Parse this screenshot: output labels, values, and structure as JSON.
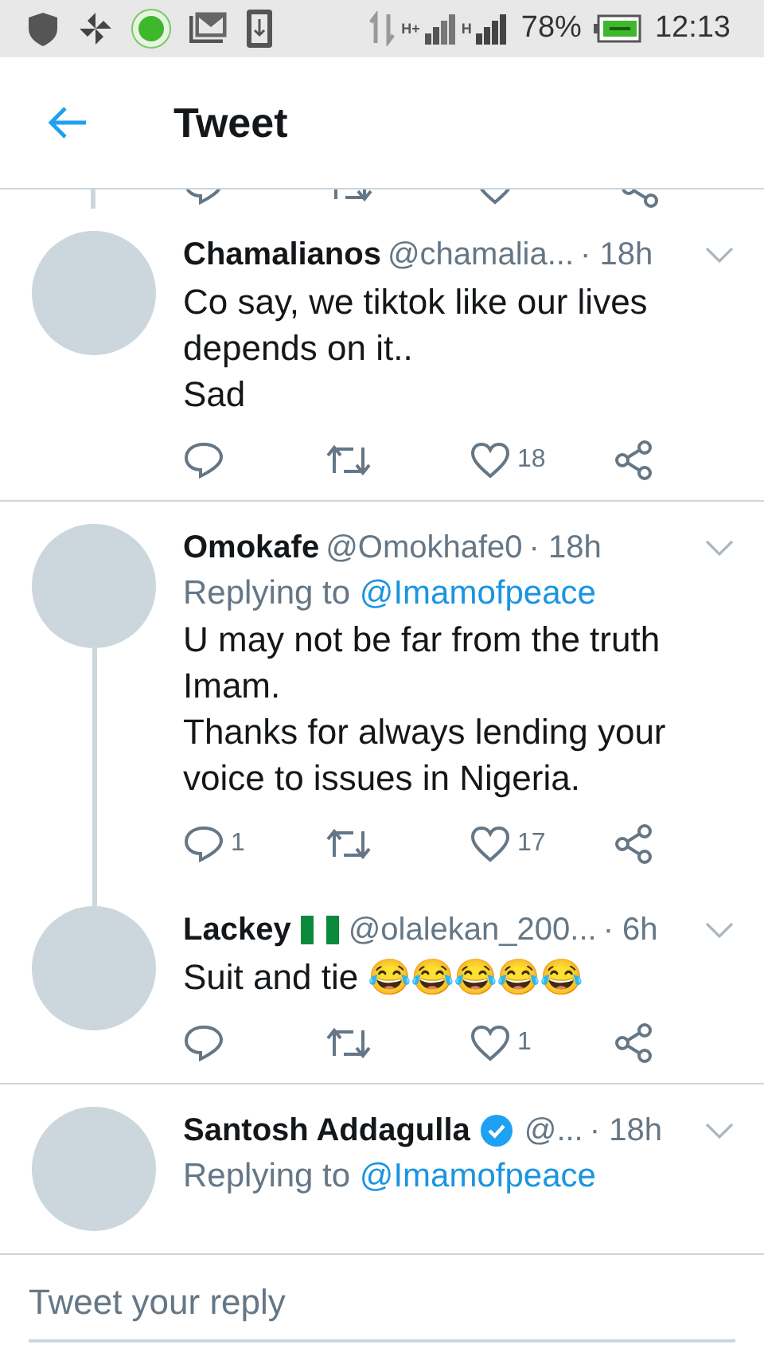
{
  "status_bar": {
    "network_labels": [
      "H+",
      "H"
    ],
    "battery": "78%",
    "time": "12:13"
  },
  "header": {
    "title": "Tweet"
  },
  "tweets": [
    {
      "name": "Chamalianos",
      "handle": "@chamalia...",
      "time": "· 18h",
      "lines": [
        "Co say, we tiktok like our lives",
        "depends on it..",
        "Sad"
      ],
      "likes": "18",
      "thread_above": false,
      "thread_below": false,
      "divider": true
    },
    {
      "name": "Omokafe",
      "handle": "@Omokhafe0",
      "time": "· 18h",
      "replying_to": {
        "label": "Replying to",
        "mention": "@Imamofpeace"
      },
      "lines": [
        "U may not be far from the truth",
        "Imam.",
        "Thanks for always lending your",
        "voice to issues in Nigeria."
      ],
      "replies": "1",
      "likes": "17",
      "thread_above": false,
      "thread_below": true,
      "divider": false
    },
    {
      "name": "Lackey",
      "badge": {
        "kind": "flag"
      },
      "handle": "@olalekan_200...",
      "time": "· 6h",
      "lines": [
        "Suit and tie 😂😂😂😂😂"
      ],
      "likes": "1",
      "thread_above": true,
      "thread_below": false,
      "divider": true
    },
    {
      "name": "Santosh Addagulla",
      "badge": {
        "kind": "verified"
      },
      "handle": "@...",
      "time": "· 18h",
      "replying_to": {
        "label": "Replying to",
        "mention": "@Imamofpeace"
      },
      "thread_above": false,
      "thread_below": false,
      "divider": false
    }
  ],
  "reply_bar": {
    "placeholder": "Tweet your reply"
  }
}
